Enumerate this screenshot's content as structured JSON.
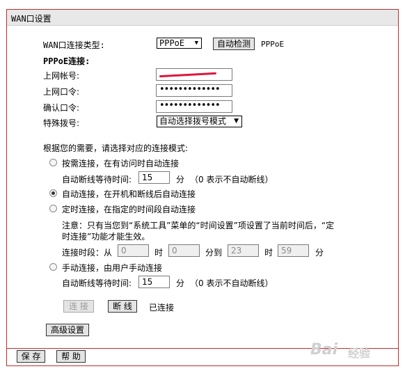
{
  "title": "WAN口设置",
  "wan_type": {
    "label": "WAN口连接类型:",
    "selected": "PPPoE",
    "detect_button": "自动检测",
    "detected": "PPPoE"
  },
  "pppoe": {
    "heading": "PPPoE连接:",
    "account_label": "上网帐号:",
    "password_label": "上网口令:",
    "password_value": "•••••••••••••",
    "confirm_label": "确认口令:",
    "confirm_value": "•••••••••••••",
    "dial_label": "特殊拨号:",
    "dial_selected": "自动选择拨号模式"
  },
  "mode": {
    "intro": "根据您的需要，请选择对应的连接模式:",
    "on_demand": "按需连接，在有访问时自动连接",
    "idle_label": "自动断线等待时间:",
    "idle_value": "15",
    "idle_unit": "分",
    "idle_hint": "（0 表示不自动断线）",
    "auto": "自动连接，在开机和断线后自动连接",
    "timed": "定时连接，在指定的时间段自动连接",
    "note_line1": "注意：只有当您到“系统工具”菜单的“时间设置”项设置了当前时间后，“定",
    "note_line2": "时连接”功能才能生效。",
    "period_label": "连接时段：从",
    "from_hour": "0",
    "hour_unit": "时",
    "from_min": "0",
    "to_label": "分到",
    "to_hour": "23",
    "to_min": "59",
    "min_unit": "分",
    "manual": "手动连接，由用户手动连接",
    "manual_idle_value": "15"
  },
  "connect_button": "连 接",
  "disconnect_button": "断 线",
  "status": "已连接",
  "advanced_button": "高级设置",
  "save_button": "保 存",
  "help_button": "帮 助",
  "watermark_text": "Bai",
  "watermark_sub": "经验"
}
